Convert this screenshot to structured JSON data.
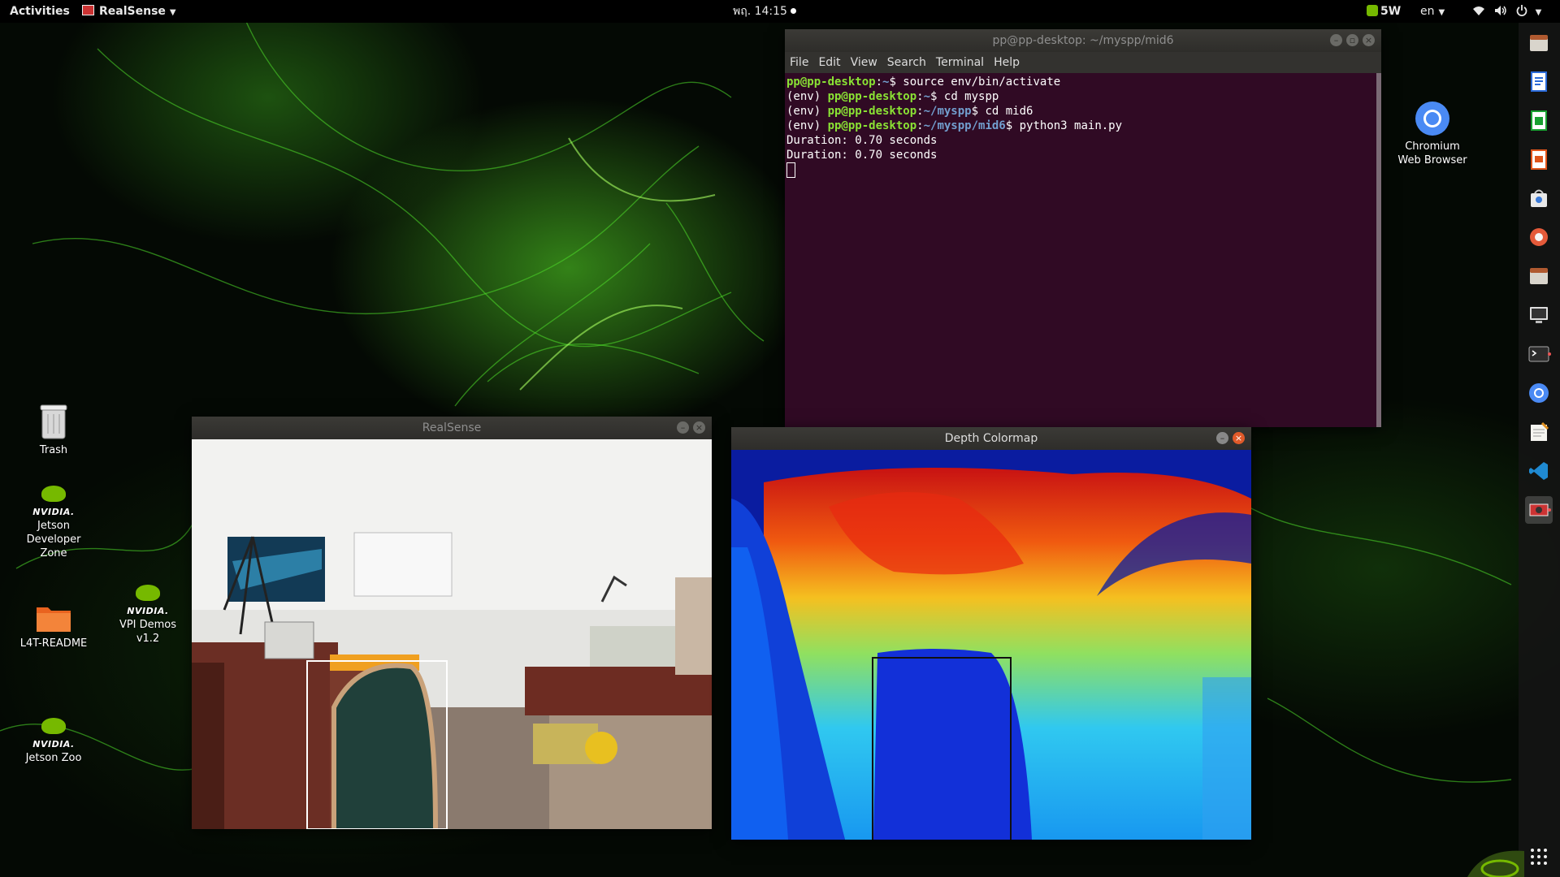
{
  "topbar": {
    "activities": "Activities",
    "app_menu": "RealSense",
    "clock": "พฤ. 14:15",
    "power_mode": "5W",
    "language": "en"
  },
  "desktop": {
    "icons": [
      {
        "label": "Trash",
        "icon": "trash-icon"
      },
      {
        "label": "Jetson Developer Zone",
        "icon": "nvidia-icon"
      },
      {
        "label": "L4T-README",
        "icon": "folder-icon"
      },
      {
        "label": "VPI Demos v1.2",
        "icon": "nvidia-icon"
      },
      {
        "label": "Jetson Zoo",
        "icon": "nvidia-icon"
      },
      {
        "label": "Chromium Web Browser",
        "icon": "chromium-icon"
      }
    ],
    "nvidia_word": "NVIDIA."
  },
  "terminal": {
    "title": "pp@pp-desktop: ~/myspp/mid6",
    "menu": [
      "File",
      "Edit",
      "View",
      "Search",
      "Terminal",
      "Help"
    ],
    "lines": [
      {
        "prefix": "",
        "user": "pp@pp-desktop",
        "path": "~",
        "cmd": "$ source env/bin/activate"
      },
      {
        "prefix": "(env) ",
        "user": "pp@pp-desktop",
        "path": "~",
        "cmd": "$ cd myspp"
      },
      {
        "prefix": "(env) ",
        "user": "pp@pp-desktop",
        "path": "~/myspp",
        "cmd": "$ cd mid6"
      },
      {
        "prefix": "(env) ",
        "user": "pp@pp-desktop",
        "path": "~/myspp/mid6",
        "cmd": "$ python3 main.py"
      }
    ],
    "output": [
      "Duration: 0.70 seconds",
      "Duration: 0.70 seconds"
    ]
  },
  "realsense_window": {
    "title": "RealSense"
  },
  "depth_window": {
    "title": "Depth Colormap"
  },
  "dock": {
    "items": [
      "files-icon",
      "writer-icon",
      "calc-icon",
      "impress-icon",
      "software-icon",
      "settings-icon",
      "files-icon",
      "monitor-icon",
      "terminal-icon",
      "chromium-icon",
      "text-editor-icon",
      "vscode-icon",
      "realsense-icon"
    ],
    "apps_grid": "show-applications-icon"
  },
  "colors": {
    "terminal_bg": "#300a24",
    "prompt_green": "#8ae234",
    "path_blue": "#729fcf",
    "nvidia_green": "#76b900",
    "depth_near": "#0a1ca0",
    "depth_far": "#d01010"
  }
}
